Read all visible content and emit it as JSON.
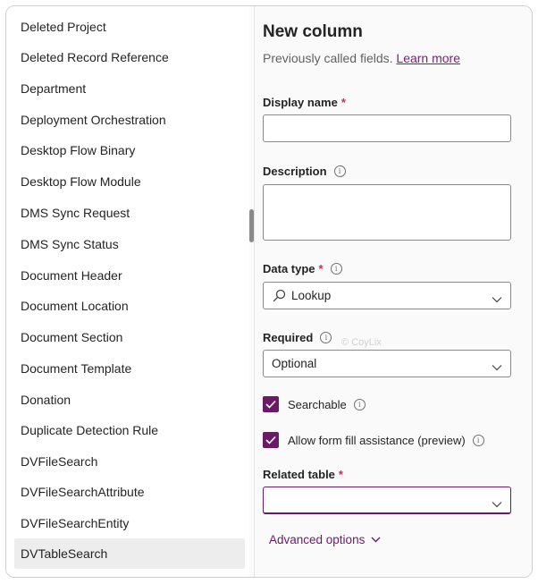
{
  "table_list": {
    "items": [
      "Deleted Project",
      "Deleted Record Reference",
      "Department",
      "Deployment Orchestration",
      "Desktop Flow Binary",
      "Desktop Flow Module",
      "DMS Sync Request",
      "DMS Sync Status",
      "Document Header",
      "Document Location",
      "Document Section",
      "Document Template",
      "Donation",
      "Duplicate Detection Rule",
      "DVFileSearch",
      "DVFileSearchAttribute",
      "DVFileSearchEntity",
      "DVTableSearch"
    ],
    "selected": "DVTableSearch"
  },
  "panel": {
    "title": "New column",
    "subtitle": "Previously called fields.",
    "learn_more": "Learn more"
  },
  "fields": {
    "display_name": {
      "label": "Display name",
      "required_mark": "*",
      "value": ""
    },
    "description": {
      "label": "Description",
      "value": ""
    },
    "data_type": {
      "label": "Data type",
      "required_mark": "*",
      "value": "Lookup",
      "icon": "search-icon"
    },
    "required": {
      "label": "Required",
      "value": "Optional"
    },
    "related_table": {
      "label": "Related table",
      "required_mark": "*",
      "value": ""
    }
  },
  "checkboxes": {
    "searchable": {
      "label": "Searchable",
      "checked": true
    },
    "form_fill": {
      "label": "Allow form fill assistance (preview)",
      "checked": true
    }
  },
  "advanced_options": "Advanced options",
  "watermark": "© CoyLix",
  "colors": {
    "accent": "#6b1a67",
    "required": "#c4314b",
    "selected_row": "#ededed"
  }
}
